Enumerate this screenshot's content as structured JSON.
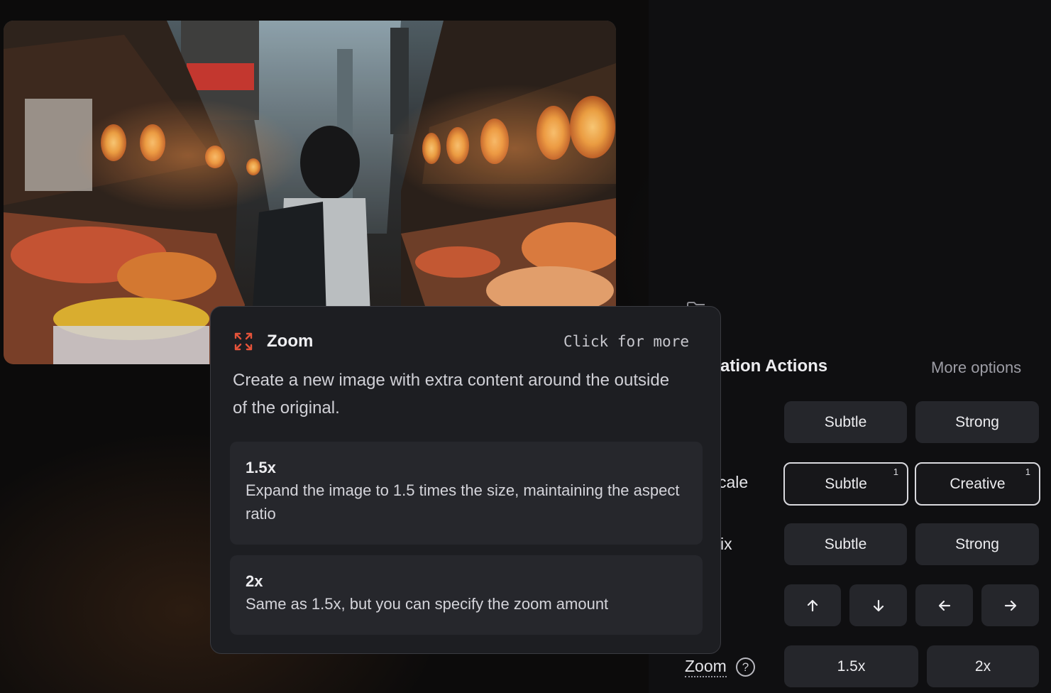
{
  "actions": {
    "section_title": "ation Actions",
    "more_options": "More options",
    "rows": [
      {
        "label": "",
        "buttons": [
          "Subtle",
          "Strong"
        ]
      },
      {
        "label": "cale",
        "buttons": [
          "Subtle",
          "Creative"
        ],
        "badges": [
          "1",
          "1"
        ]
      },
      {
        "label": "ix",
        "buttons": [
          "Subtle",
          "Strong"
        ]
      }
    ],
    "pan_icons": [
      "arrow-up-icon",
      "arrow-down-icon",
      "arrow-left-icon",
      "arrow-right-icon"
    ],
    "zoom_label": "Zoom",
    "help_glyph": "?",
    "zoom_buttons": [
      "1.5x",
      "2x"
    ]
  },
  "tooltip": {
    "icon": "expand-corners-icon",
    "title": "Zoom",
    "hint": "Click for more",
    "description": "Create a new image with extra content around the outside of the original.",
    "options": [
      {
        "title": "1.5x",
        "description": "Expand the image to 1.5 times the size, maintaining the aspect ratio"
      },
      {
        "title": "2x",
        "description": "Same as 1.5x, but you can specify the zoom amount"
      }
    ]
  },
  "colors": {
    "accent": "#e5533a",
    "background": "#0c0b0b",
    "button": "#25262b",
    "tooltip": "#1d1e22",
    "lantern": "#f0a03c"
  }
}
